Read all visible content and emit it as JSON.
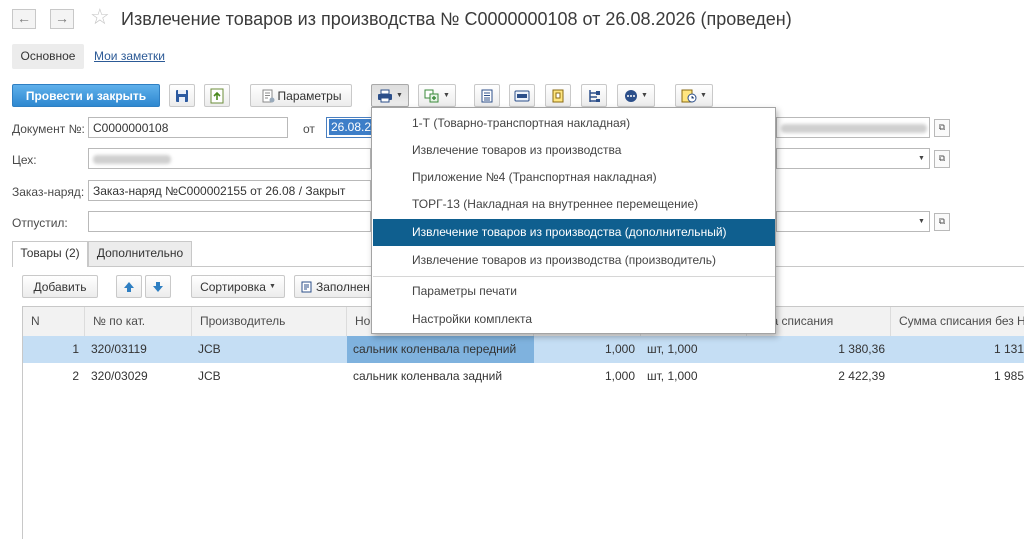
{
  "window": {
    "title": "Извлечение товаров из производства № С0000000108 от 26.08.2026 (проведен)",
    "back_icon": "←",
    "forward_icon": "→"
  },
  "sections": {
    "main": "Основное",
    "notes": "Мои заметки"
  },
  "toolbar": {
    "post_close": "Провести и закрыть",
    "params": "Параметры",
    "fill": "Заполнен"
  },
  "form": {
    "doc_label": "Документ №:",
    "doc_value": "С0000000108",
    "from_label": "от",
    "date_value": "26.08.2",
    "shop_label": "Цех:",
    "order_label": "Заказ-наряд:",
    "order_value": "Заказ-наряд №С000002155  от 26.08 / Закрыт",
    "released_label": "Отпустил:"
  },
  "tabs": {
    "goods": "Товары (2)",
    "extra": "Дополнительно"
  },
  "grid_toolbar": {
    "add": "Добавить",
    "sort": "Сортировка"
  },
  "table": {
    "headers": [
      "N",
      "№ по кат.",
      "Производитель",
      "Но",
      "",
      "",
      "мма списания",
      "Сумма списания без Н"
    ],
    "rows": [
      [
        "1",
        "320/03119",
        "JCB",
        "сальник коленвала передний",
        "1,000",
        "шт, 1,000",
        "1 380,36",
        "1 131"
      ],
      [
        "2",
        "320/03029",
        "JCB",
        "сальник коленвала задний",
        "1,000",
        "шт, 1,000",
        "2 422,39",
        "1 985"
      ]
    ]
  },
  "print_menu": {
    "items": [
      "1-Т (Товарно-транспортная накладная)",
      "Извлечение товаров из производства",
      "Приложение №4 (Транспортная накладная)",
      "ТОРГ-13 (Накладная на внутреннее перемещение)",
      "Извлечение товаров из производства (дополнительный)",
      "Извлечение товаров из производства (производитель)"
    ],
    "settings": [
      "Параметры печати",
      "Настройки комплекта"
    ]
  },
  "colors": {
    "accent": "#2e88d0",
    "menu_highlight": "#0f5f8f",
    "row_selected": "#c5def4"
  }
}
